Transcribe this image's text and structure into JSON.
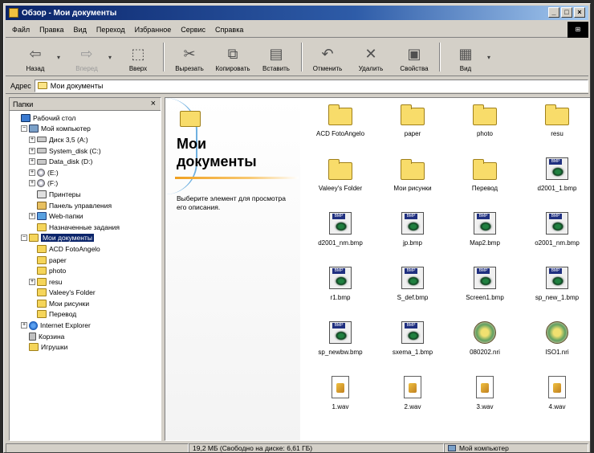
{
  "window": {
    "title": "Обзор - Мои документы",
    "controls": [
      "_",
      "□",
      "×"
    ],
    "logo_text": "⊞"
  },
  "menu": [
    "Файл",
    "Правка",
    "Вид",
    "Переход",
    "Избранное",
    "Сервис",
    "Справка"
  ],
  "toolbar": {
    "back": "Назад",
    "forward": "Вперед",
    "up": "Вверх",
    "cut": "Вырезать",
    "copy": "Копировать",
    "paste": "Вставить",
    "undo": "Отменить",
    "delete": "Удалить",
    "properties": "Свойства",
    "view": "Вид"
  },
  "address": {
    "label": "Адрес",
    "value": "Мои документы"
  },
  "folders_panel": {
    "title": "Папки",
    "close": "×",
    "tree": [
      {
        "label": "Рабочий стол",
        "icon": "desktop",
        "indent": 0,
        "pm": ""
      },
      {
        "label": "Мой компьютер",
        "icon": "computer",
        "indent": 1,
        "pm": "−"
      },
      {
        "label": "Диск 3,5 (A:)",
        "icon": "drive",
        "indent": 2,
        "pm": "+"
      },
      {
        "label": "System_disk (C:)",
        "icon": "drive",
        "indent": 2,
        "pm": "+"
      },
      {
        "label": "Data_disk (D:)",
        "icon": "drive",
        "indent": 2,
        "pm": "+"
      },
      {
        "label": "(E:)",
        "icon": "cd",
        "indent": 2,
        "pm": "+"
      },
      {
        "label": "(F:)",
        "icon": "cd",
        "indent": 2,
        "pm": "+"
      },
      {
        "label": "Принтеры",
        "icon": "printer",
        "indent": 2,
        "pm": ""
      },
      {
        "label": "Панель управления",
        "icon": "cpl",
        "indent": 2,
        "pm": ""
      },
      {
        "label": "Web-папки",
        "icon": "web",
        "indent": 2,
        "pm": "+"
      },
      {
        "label": "Назначенные задания",
        "icon": "folder",
        "indent": 2,
        "pm": ""
      },
      {
        "label": "Мои документы",
        "icon": "folder",
        "indent": 1,
        "pm": "−",
        "selected": true
      },
      {
        "label": "ACD FotoAngelo",
        "icon": "folder",
        "indent": 2,
        "pm": ""
      },
      {
        "label": "paper",
        "icon": "folder",
        "indent": 2,
        "pm": ""
      },
      {
        "label": "photo",
        "icon": "folder",
        "indent": 2,
        "pm": ""
      },
      {
        "label": "resu",
        "icon": "folder",
        "indent": 2,
        "pm": "+"
      },
      {
        "label": "Valeey's Folder",
        "icon": "folder",
        "indent": 2,
        "pm": ""
      },
      {
        "label": "Мои рисунки",
        "icon": "folder",
        "indent": 2,
        "pm": ""
      },
      {
        "label": "Перевод",
        "icon": "folder",
        "indent": 2,
        "pm": ""
      },
      {
        "label": "Internet Explorer",
        "icon": "ie",
        "indent": 1,
        "pm": "+"
      },
      {
        "label": "Корзина",
        "icon": "bin",
        "indent": 1,
        "pm": ""
      },
      {
        "label": "Игрушки",
        "icon": "folder",
        "indent": 1,
        "pm": ""
      }
    ]
  },
  "webview": {
    "title_line1": "Мои",
    "title_line2": "документы",
    "hint": "Выберите элемент для просмотра его описания."
  },
  "files": [
    {
      "name": "ACD FotoAngelo",
      "type": "folder"
    },
    {
      "name": "paper",
      "type": "folder"
    },
    {
      "name": "photo",
      "type": "folder"
    },
    {
      "name": "resu",
      "type": "folder"
    },
    {
      "name": "Valeey's Folder",
      "type": "folder"
    },
    {
      "name": "Мои рисунки",
      "type": "folder"
    },
    {
      "name": "Перевод",
      "type": "folder"
    },
    {
      "name": "d2001_1.bmp",
      "type": "bmp"
    },
    {
      "name": "d2001_nm.bmp",
      "type": "bmp"
    },
    {
      "name": "jp.bmp",
      "type": "bmp"
    },
    {
      "name": "Map2.bmp",
      "type": "bmp"
    },
    {
      "name": "o2001_nm.bmp",
      "type": "bmp"
    },
    {
      "name": "r1.bmp",
      "type": "bmp"
    },
    {
      "name": "S_def.bmp",
      "type": "bmp"
    },
    {
      "name": "Screen1.bmp",
      "type": "bmp"
    },
    {
      "name": "sp_new_1.bmp",
      "type": "bmp"
    },
    {
      "name": "sp_newbw.bmp",
      "type": "bmp"
    },
    {
      "name": "sxema_1.bmp",
      "type": "bmp"
    },
    {
      "name": "080202.nri",
      "type": "nri"
    },
    {
      "name": "ISO1.nri",
      "type": "nri"
    },
    {
      "name": "1.wav",
      "type": "wav"
    },
    {
      "name": "2.wav",
      "type": "wav"
    },
    {
      "name": "3.wav",
      "type": "wav"
    },
    {
      "name": "4.wav",
      "type": "wav"
    }
  ],
  "status": {
    "size": "19,2 МБ (Свободно на диске: 6,61 ГБ)",
    "location": "Мой компьютер"
  }
}
